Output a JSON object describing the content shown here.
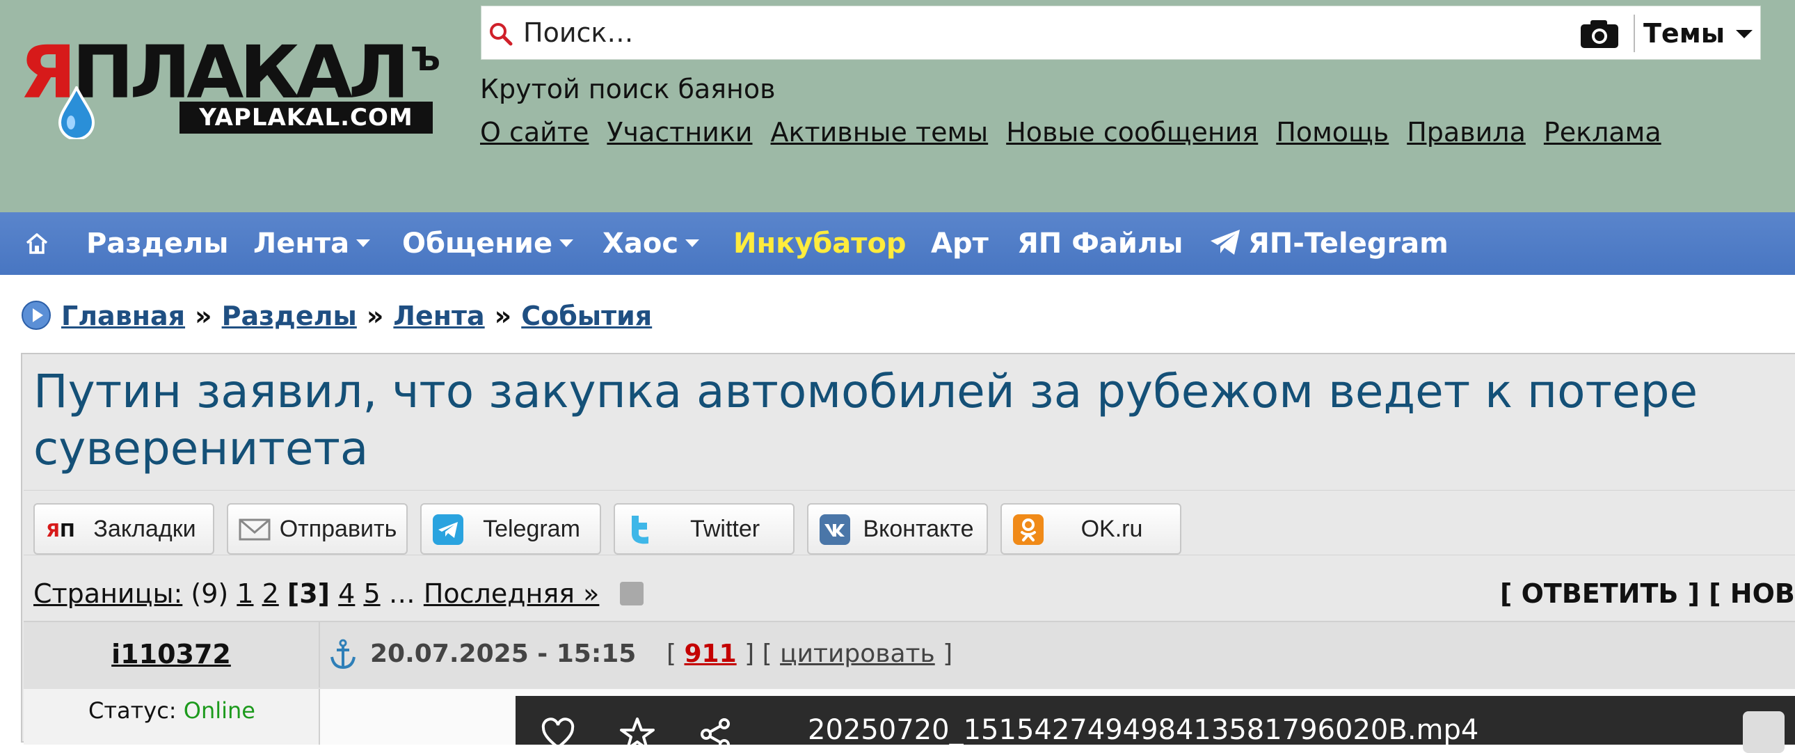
{
  "site": {
    "logo_text_a": "Я",
    "logo_text_b": "ПЛАКАЛ",
    "logo_hard_sign": "Ъ",
    "logo_domain": "YAPLAKAL.COM",
    "subtitle": "Крутой поиск баянов"
  },
  "search": {
    "placeholder": "Поиск…",
    "scope_label": "Темы",
    "icons": [
      "search-icon",
      "camera-icon"
    ]
  },
  "top_links": [
    "О сайте",
    "Участники",
    "Активные темы",
    "Новые сообщения",
    "Помощь",
    "Правила",
    "Реклама"
  ],
  "nav": {
    "home_icon": "home-icon",
    "items": [
      {
        "label": "Разделы",
        "dropdown": false,
        "color": "#ffffff"
      },
      {
        "label": "Лента",
        "dropdown": true,
        "color": "#ffffff"
      },
      {
        "label": "Общение",
        "dropdown": true,
        "color": "#ffffff"
      },
      {
        "label": "Хаос",
        "dropdown": true,
        "color": "#ffffff"
      },
      {
        "label": "Инкубатор",
        "dropdown": false,
        "color": "#ffec3d"
      },
      {
        "label": "Арт",
        "dropdown": false,
        "color": "#ffffff"
      },
      {
        "label": "ЯП Файлы",
        "dropdown": false,
        "color": "#ffffff"
      },
      {
        "label": "ЯП-Telegram",
        "dropdown": false,
        "color": "#ffffff",
        "icon": "telegram-icon"
      }
    ]
  },
  "breadcrumb": {
    "icon": "play-icon",
    "separator": "»",
    "items": [
      "Главная",
      "Разделы",
      "Лента",
      "События"
    ]
  },
  "topic": {
    "title": "Путин заявил, что закупка автомобилей за рубежом ведет к потере суверенитета"
  },
  "share_buttons": [
    {
      "label": "Закладки",
      "icon": "yap-bookmark-icon"
    },
    {
      "label": "Отправить",
      "icon": "envelope-icon"
    },
    {
      "label": "Telegram",
      "icon": "telegram-icon"
    },
    {
      "label": "Twitter",
      "icon": "twitter-icon"
    },
    {
      "label": "Вконтакте",
      "icon": "vk-icon"
    },
    {
      "label": "OK.ru",
      "icon": "ok-icon"
    }
  ],
  "pagination": {
    "label": "Страницы:",
    "total": "(9)",
    "pages": [
      "1",
      "2",
      "[3]",
      "4",
      "5"
    ],
    "ellipsis": "…",
    "last": "Последняя »"
  },
  "actions": {
    "text": "[ ОТВЕТИТЬ ] [ НОВА"
  },
  "post": {
    "author": "i110372",
    "anchor_icon": "anchor-icon",
    "date": "20.07.2025 - 15:15",
    "bracket_open": "[",
    "number": "911",
    "bracket_mid": "] [",
    "quote": "цитировать",
    "bracket_close": "]",
    "status_label": "Статус:",
    "status_value": "Online",
    "video_filename": "20250720_151542749498413581796020B.mp4",
    "video_icons": [
      "heart-icon",
      "star-icon",
      "share-icon"
    ]
  },
  "colors": {
    "header_bg": "#9db9a6",
    "nav_bg": "#4f7dc7",
    "title": "#145077",
    "link": "#1f4f82",
    "online": "#1d9a1d",
    "post_number": "#c40000"
  }
}
